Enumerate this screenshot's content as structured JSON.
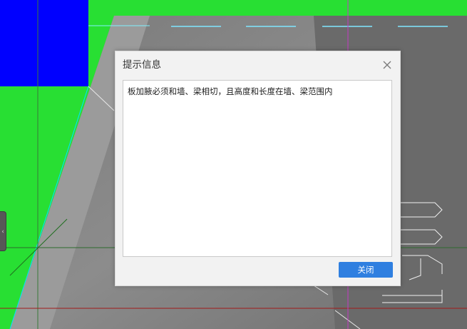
{
  "dialog": {
    "title": "提示信息",
    "message": "板加腋必须和墙、梁相切，且高度和长度在墙、梁范围内",
    "close_button_label": "关闭"
  },
  "icons": {
    "dialog_close": "close-icon",
    "side_tab": "chevron-left-icon"
  },
  "colors": {
    "canvas_background": "#28df33",
    "blue_block": "#0000ff",
    "accent_button": "#2f7fe0"
  }
}
